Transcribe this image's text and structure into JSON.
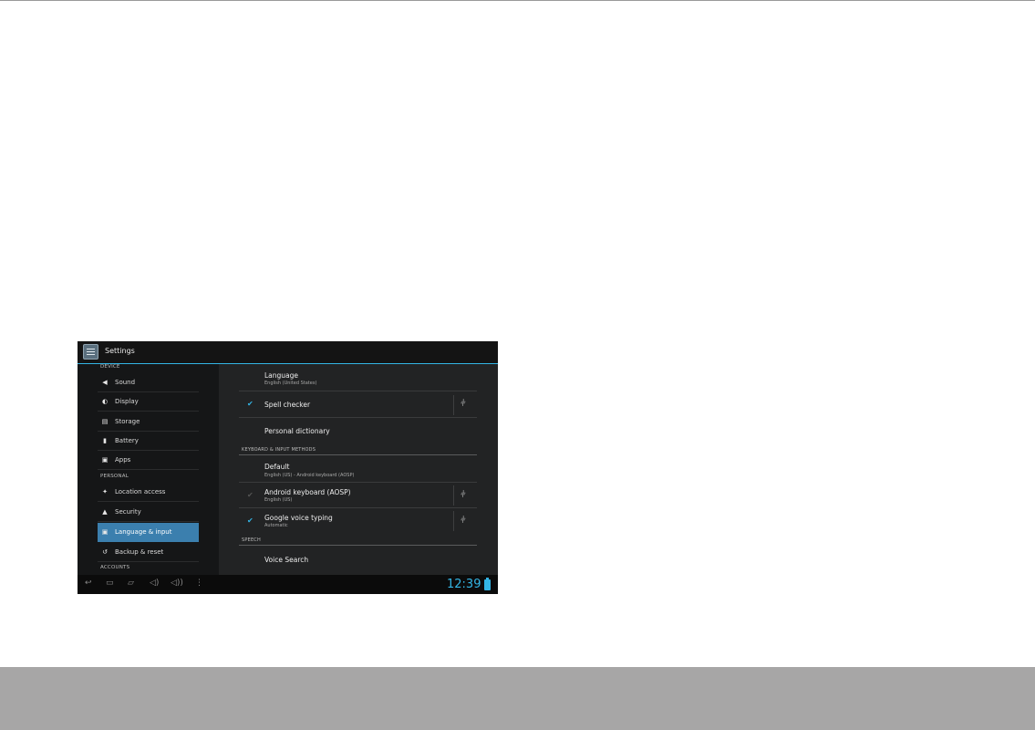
{
  "app": {
    "title": "Settings"
  },
  "sidebar": {
    "headers": {
      "device": "DEVICE",
      "personal": "PERSONAL",
      "accounts": "ACCOUNTS"
    },
    "items": [
      {
        "label": "Sound",
        "icon": "sound-icon"
      },
      {
        "label": "Display",
        "icon": "display-icon"
      },
      {
        "label": "Storage",
        "icon": "storage-icon"
      },
      {
        "label": "Battery",
        "icon": "battery-icon"
      },
      {
        "label": "Apps",
        "icon": "apps-icon"
      },
      {
        "label": "Location access",
        "icon": "location-icon"
      },
      {
        "label": "Security",
        "icon": "lock-icon"
      },
      {
        "label": "Language & input",
        "icon": "language-icon",
        "selected": true
      },
      {
        "label": "Backup & reset",
        "icon": "backup-icon"
      }
    ]
  },
  "content": {
    "language": {
      "title": "Language",
      "summary": "English (United States)"
    },
    "spell_checker": {
      "title": "Spell checker",
      "checked": true
    },
    "personal_dictionary": {
      "title": "Personal dictionary"
    },
    "section_keyboard": "KEYBOARD & INPUT METHODS",
    "default_ime": {
      "title": "Default",
      "summary": "English (US) - Android keyboard (AOSP)"
    },
    "android_keyboard": {
      "title": "Android keyboard (AOSP)",
      "summary": "English (US)",
      "checked": true
    },
    "google_voice": {
      "title": "Google voice typing",
      "summary": "Automatic",
      "checked": true
    },
    "section_speech": "SPEECH",
    "voice_search": {
      "title": "Voice Search"
    }
  },
  "statusbar": {
    "time": "12:39"
  },
  "colors": {
    "accent": "#33b5e5",
    "selected": "#3b7fae",
    "background": "#232425"
  }
}
